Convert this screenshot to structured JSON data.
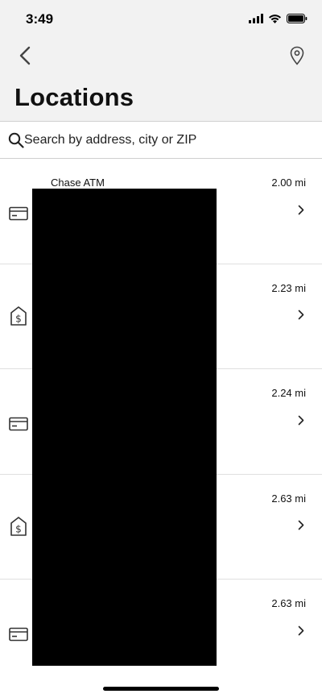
{
  "status_bar": {
    "time": "3:49",
    "icons": [
      "signal-icon",
      "wifi-icon",
      "battery-icon"
    ]
  },
  "nav": {
    "back_icon": "chevron-left-icon",
    "map_icon": "location-pin-icon",
    "title": "Locations"
  },
  "search": {
    "icon": "search-icon",
    "placeholder": "Search by address, city or ZIP"
  },
  "locations": [
    {
      "type": "atm",
      "icon": "atm-card-icon",
      "name": "Chase ATM",
      "distance": "2.00 mi"
    },
    {
      "type": "branch",
      "icon": "branch-dollar-icon",
      "name": "",
      "distance": "2.23 mi"
    },
    {
      "type": "atm",
      "icon": "atm-card-icon",
      "name": "",
      "distance": "2.24 mi"
    },
    {
      "type": "branch",
      "icon": "branch-dollar-icon",
      "name": "",
      "distance": "2.63 mi"
    },
    {
      "type": "atm",
      "icon": "atm-card-icon",
      "name": "",
      "distance": "2.63 mi"
    }
  ],
  "colors": {
    "header_bg": "#f2f2f2",
    "text": "#111111",
    "divider": "#e0e0e0",
    "redaction": "#000000"
  }
}
